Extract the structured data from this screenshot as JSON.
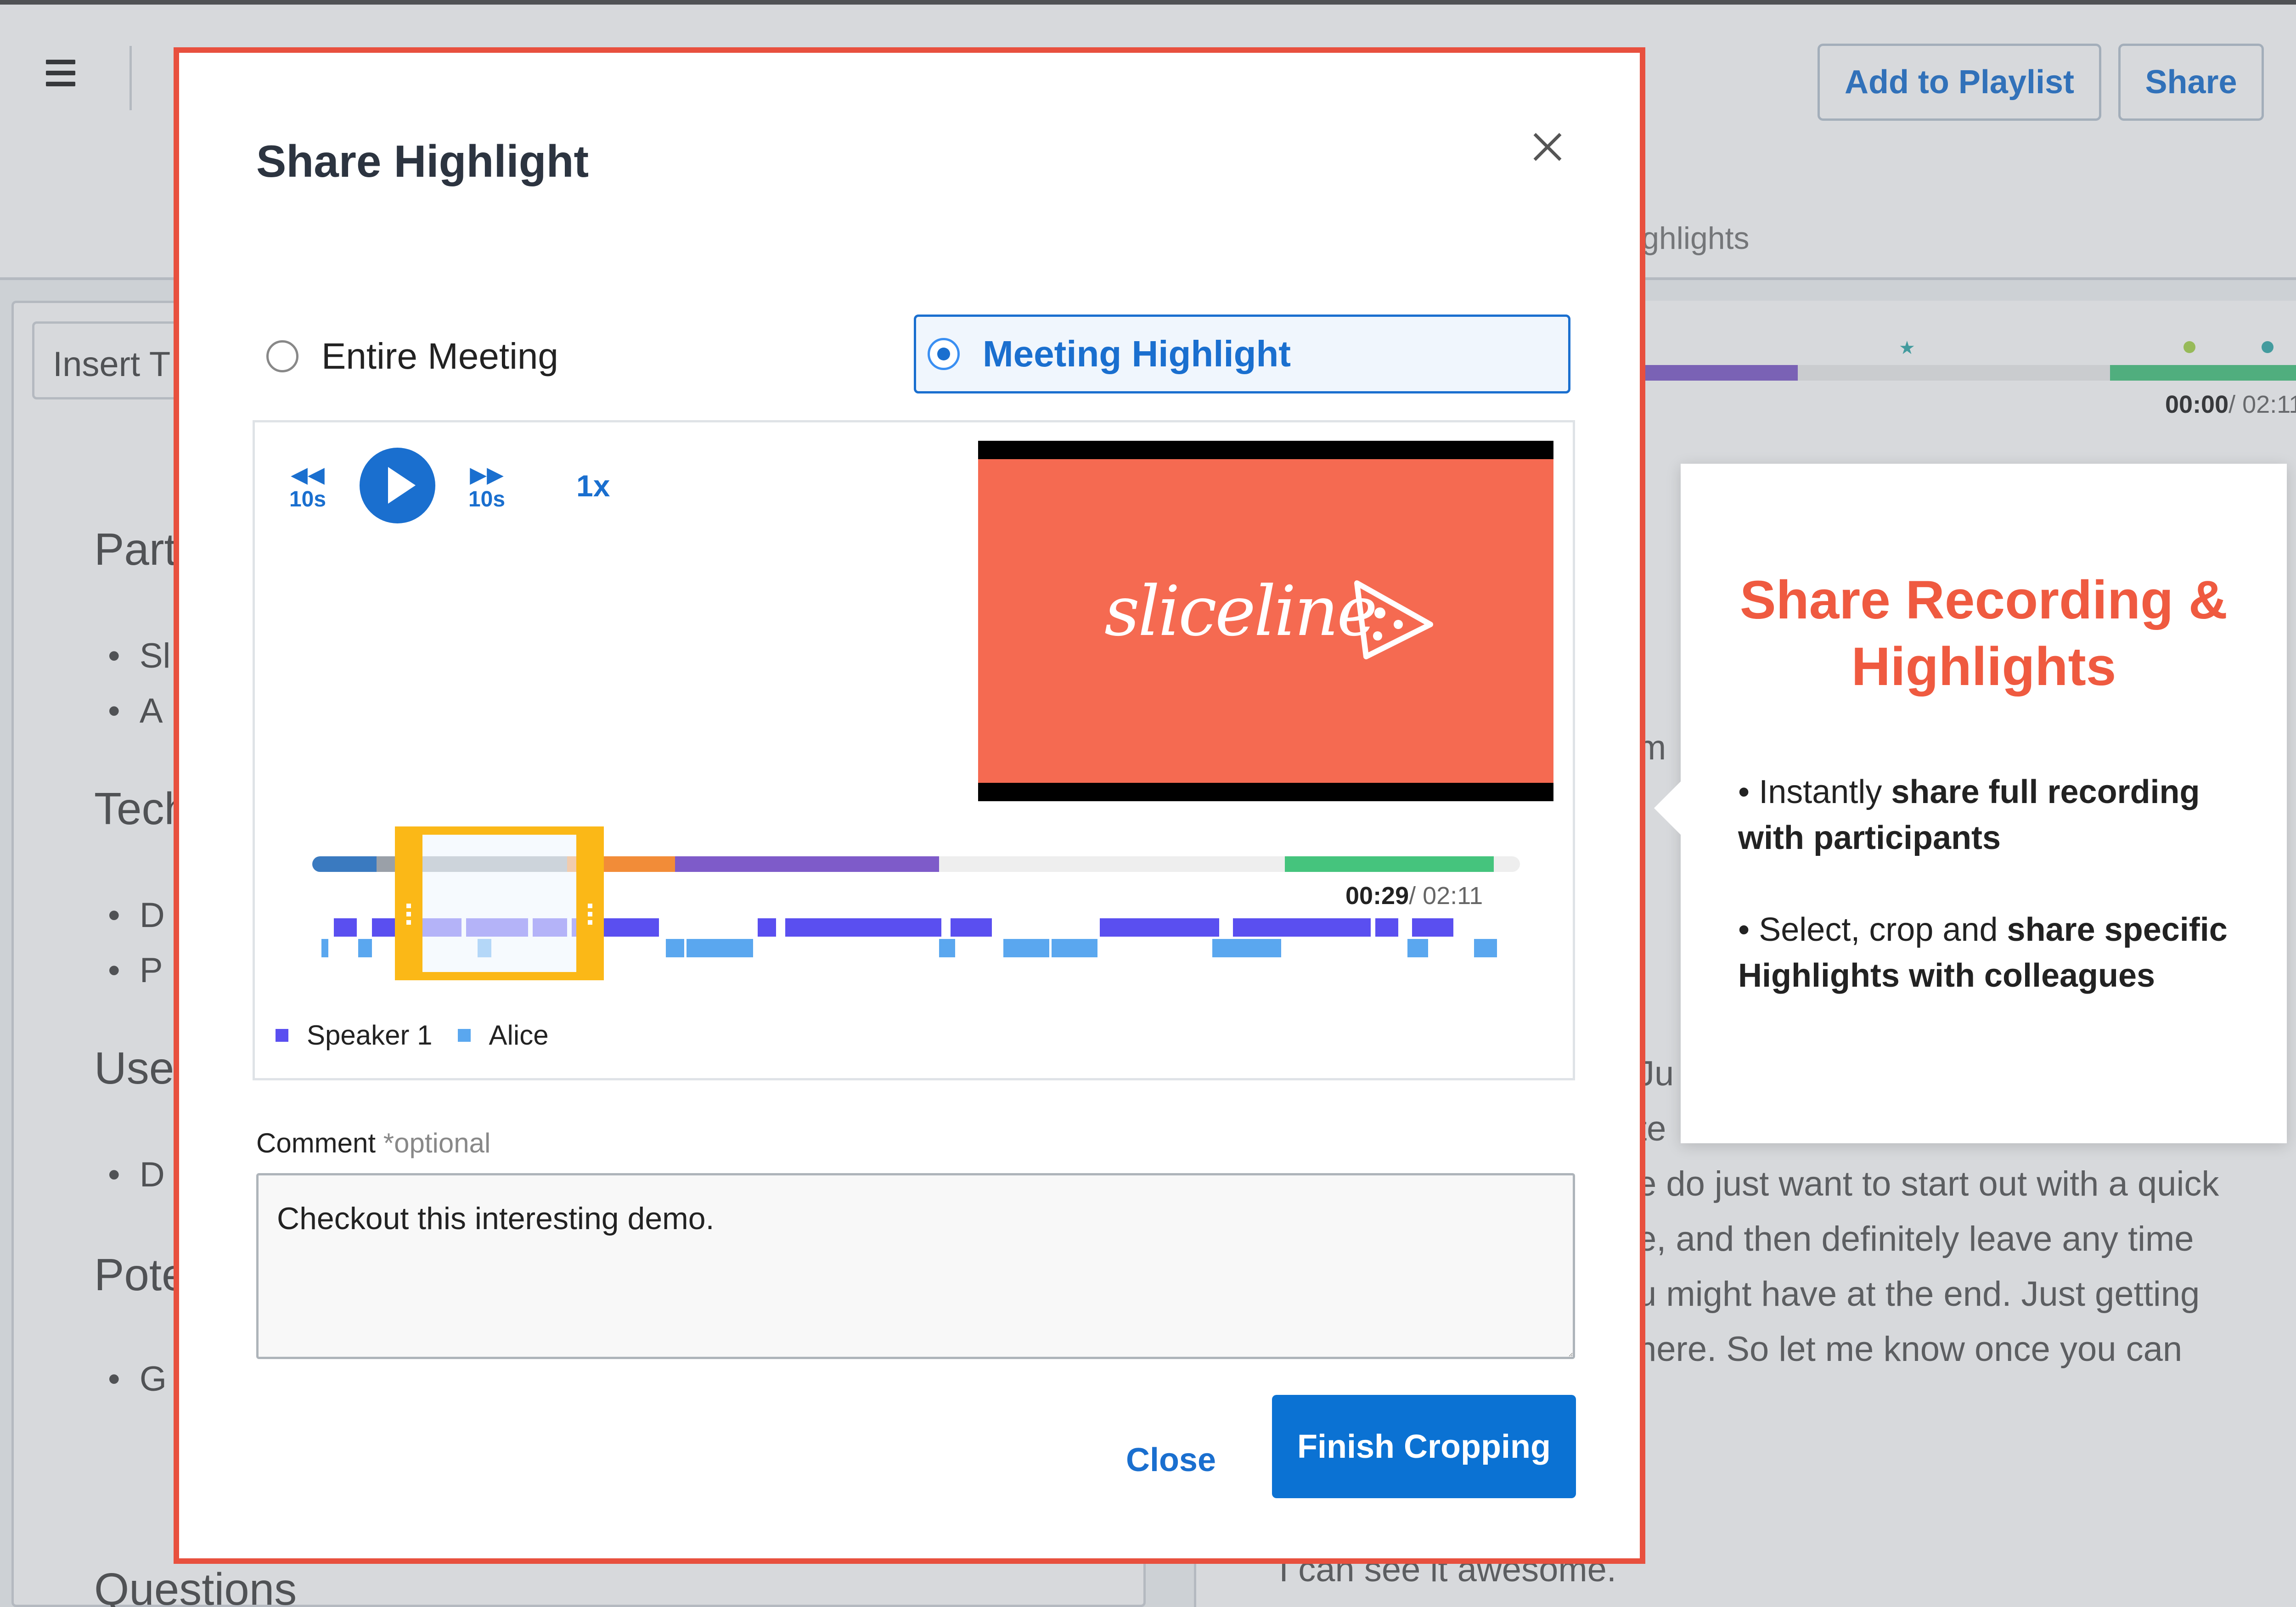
{
  "header": {
    "add_to_playlist_label": "Add to Playlist",
    "share_label": "Share",
    "tab_partial": "ighlights"
  },
  "left_panel": {
    "insert_partial": "Insert T",
    "sections": [
      {
        "heading": "Part",
        "bullets": [
          "Sl",
          "A"
        ]
      },
      {
        "heading": "Tech",
        "bullets": [
          "D",
          "P"
        ]
      },
      {
        "heading": "Use",
        "bullets": [
          "D"
        ]
      },
      {
        "heading": "Pote",
        "bullets": [
          "G"
        ]
      },
      {
        "heading": "Questions",
        "bullets": []
      }
    ]
  },
  "right_panel": {
    "time_current": "00:00",
    "time_total": "/ 02:11",
    "transcript_lines": [
      "m",
      "Ju",
      "te",
      "e do just want to start out with a quick",
      "e, and then definitely leave any time",
      "u might have at the end. Just getting",
      "here. So let me know once you can",
      "I can see it awesome."
    ]
  },
  "callout": {
    "title": "Share Recording & Highlights",
    "point1_prefix": "• Instantly ",
    "point1_bold": "share full recording with participants",
    "point2_prefix": "• Select, crop and ",
    "point2_bold": "share specific Highlights with colleagues"
  },
  "modal": {
    "title": "Share Highlight",
    "option_entire": "Entire Meeting",
    "option_highlight": "Meeting Highlight",
    "selected_option": "Meeting Highlight",
    "player": {
      "rewind_label": "10s",
      "forward_label": "10s",
      "speed": "1x",
      "video_logo_text": "sliceline",
      "time_current": "00:29",
      "time_total": "/ 02:11"
    },
    "legend": [
      {
        "name": "Speaker 1",
        "color": "#5a4ff0"
      },
      {
        "name": "Alice",
        "color": "#5aa7ef"
      }
    ],
    "comment_label": "Comment",
    "comment_optional": "*optional",
    "comment_value": "Checkout this interesting demo.",
    "close_label": "Close",
    "finish_label": "Finish Cropping"
  },
  "colors": {
    "accent": "#1a6fcf",
    "modal_border": "#e8503e",
    "callout_title": "#ef5a40",
    "crop_handle": "#fbb817",
    "video_bg": "#f56a51"
  }
}
